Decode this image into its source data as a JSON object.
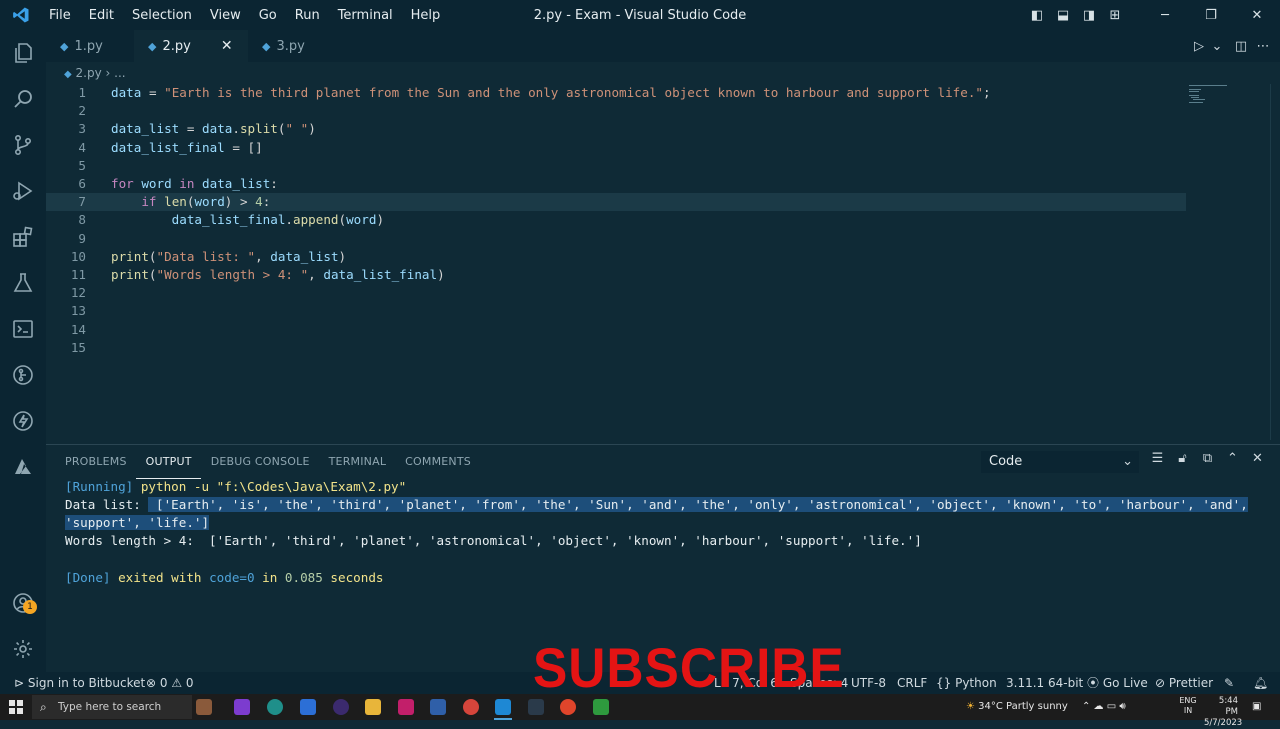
{
  "window": {
    "title": "2.py - Exam - Visual Studio Code",
    "menu": [
      "File",
      "Edit",
      "Selection",
      "View",
      "Go",
      "Run",
      "Terminal",
      "Help"
    ]
  },
  "tabs": [
    {
      "label": "1.py",
      "active": false
    },
    {
      "label": "2.py",
      "active": true
    },
    {
      "label": "3.py",
      "active": false
    }
  ],
  "breadcrumb": {
    "file": "2.py",
    "more": "..."
  },
  "editor": {
    "lines": [
      {
        "n": "1",
        "t": "data = \"Earth is the third planet from the Sun and the only astronomical object known to harbour and support life.\";"
      },
      {
        "n": "2",
        "t": ""
      },
      {
        "n": "3",
        "t": "data_list = data.split(\" \")"
      },
      {
        "n": "4",
        "t": "data_list_final = []"
      },
      {
        "n": "5",
        "t": ""
      },
      {
        "n": "6",
        "t": "for word in data_list:"
      },
      {
        "n": "7",
        "t": "    if len(word) > 4:"
      },
      {
        "n": "8",
        "t": "        data_list_final.append(word)"
      },
      {
        "n": "9",
        "t": ""
      },
      {
        "n": "10",
        "t": "print(\"Data list: \", data_list)"
      },
      {
        "n": "11",
        "t": "print(\"Words length > 4: \", data_list_final)"
      },
      {
        "n": "12",
        "t": ""
      },
      {
        "n": "13",
        "t": ""
      },
      {
        "n": "14",
        "t": ""
      },
      {
        "n": "15",
        "t": ""
      }
    ],
    "current_line": 7
  },
  "panel": {
    "tabs": [
      "PROBLEMS",
      "OUTPUT",
      "DEBUG CONSOLE",
      "TERMINAL",
      "COMMENTS"
    ],
    "active_tab": "OUTPUT",
    "channel": "Code",
    "output": {
      "running_tag": "[Running]",
      "running_cmd": " python -u \"f:\\Codes\\Java\\Exam\\2.py\"",
      "data_label": "Data list: ",
      "data_list_1": " ['Earth', 'is', 'the', 'third', 'planet', 'from', 'the', 'Sun', 'and', 'the', 'only', 'astronomical', 'object', 'known', 'to', 'harbour', 'and',",
      "data_list_2": "'support', 'life.']",
      "words_line": "Words length > 4:  ['Earth', 'third', 'planet', 'astronomical', 'object', 'known', 'harbour', 'support', 'life.']",
      "done_tag": "[Done]",
      "done_text_1": " exited with ",
      "done_code": "code=0",
      "done_text_2": " in ",
      "done_seconds": "0.085",
      "done_text_3": " seconds"
    }
  },
  "overlay": {
    "subscribe": "SUBSCRIBE"
  },
  "activity": {
    "badge": "1"
  },
  "status": {
    "bitbucket": "Sign in to Bitbucket",
    "problems": "⊗ 0 ⚠ 0",
    "position": "Ln 7, Col 6",
    "spaces": "Spaces: 4",
    "encoding": "UTF-8",
    "eol": "CRLF",
    "language": "Python",
    "interpreter": "3.11.1 64-bit",
    "golive": "Go Live",
    "prettier": "Prettier"
  },
  "taskbar": {
    "search_placeholder": "Type here to search",
    "weather": "34°C  Partly sunny",
    "lang_top": "ENG",
    "lang_bottom": "IN",
    "time": "5:44 PM",
    "date": "5/7/2023"
  },
  "colors": {
    "accent": "#4fa3d9",
    "subscribe": "#e41414",
    "bg": "#0f2a36"
  }
}
